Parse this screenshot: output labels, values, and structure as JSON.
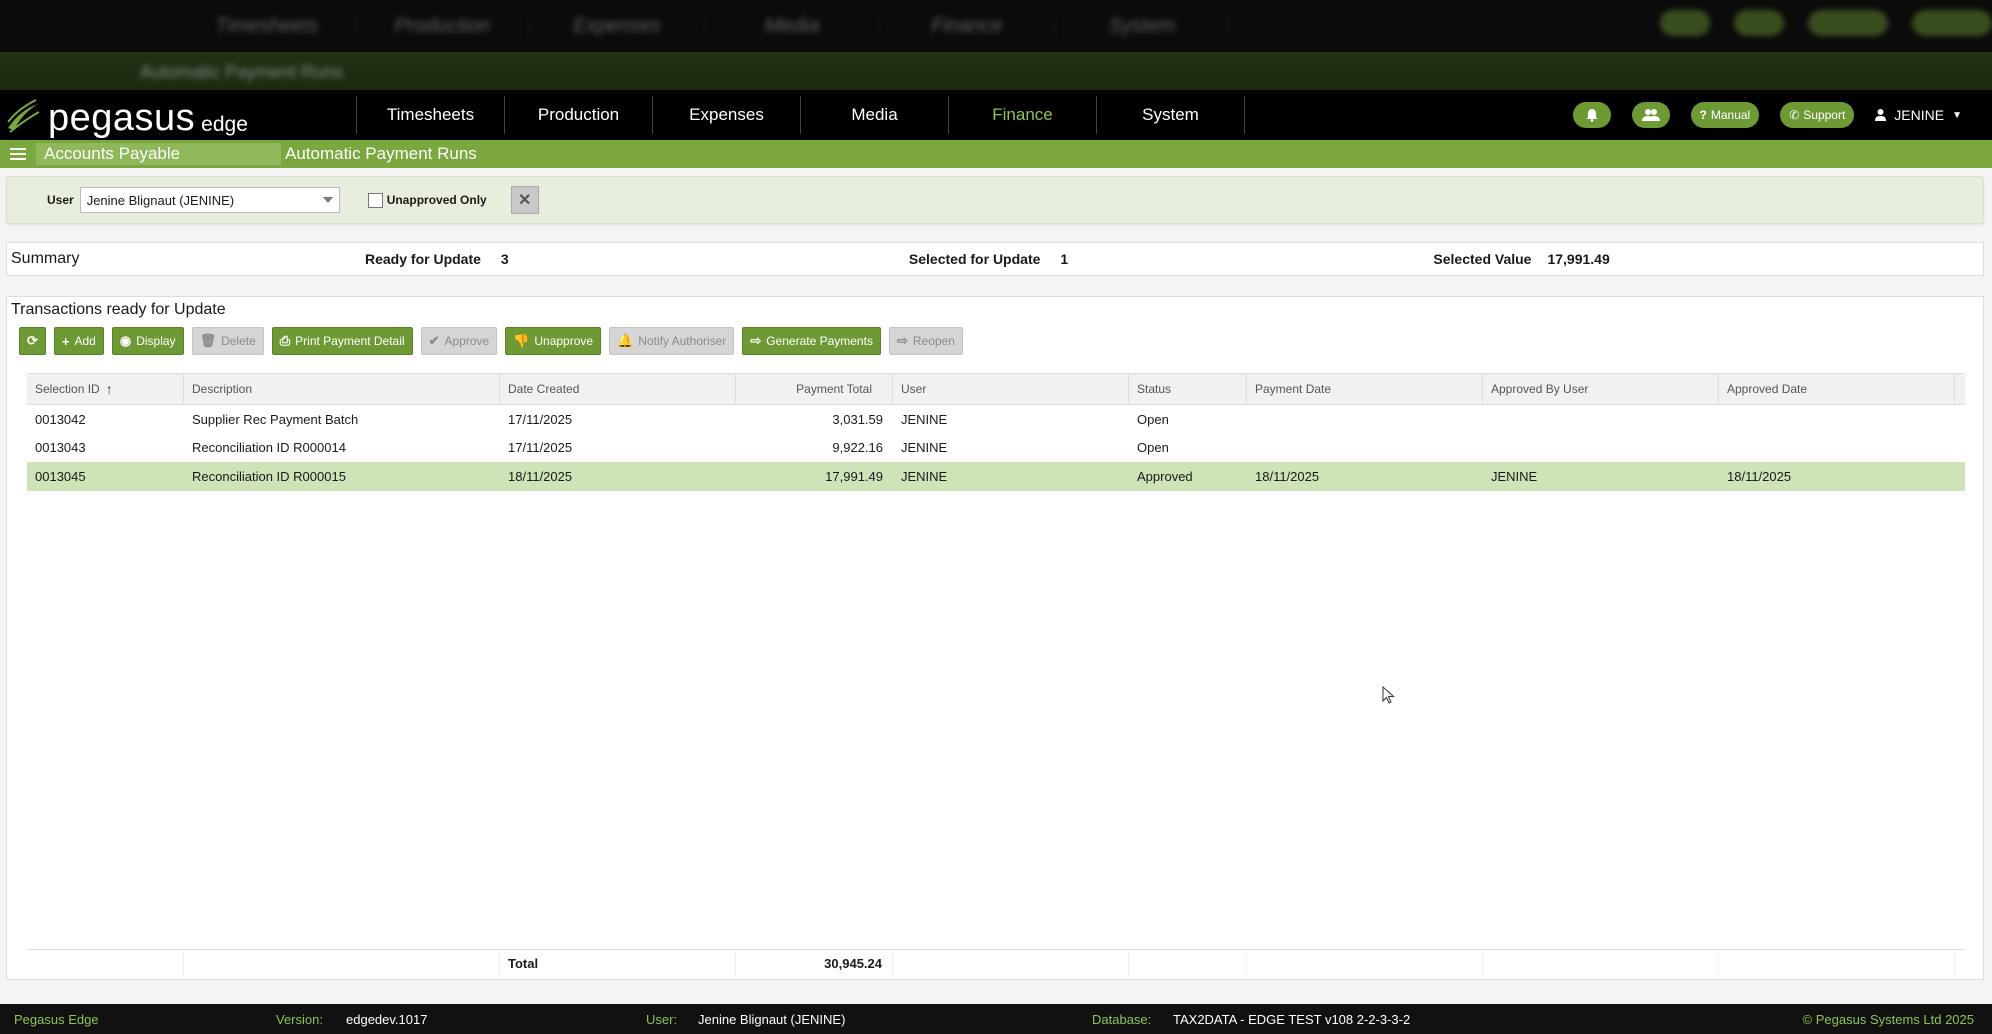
{
  "app": {
    "logo_text": "pegasus",
    "logo_sub": "edge",
    "accent": "#7aa83e"
  },
  "nav": {
    "items": [
      {
        "label": "Timesheets"
      },
      {
        "label": "Production"
      },
      {
        "label": "Expenses"
      },
      {
        "label": "Media"
      },
      {
        "label": "Finance",
        "active": true
      },
      {
        "label": "System"
      }
    ],
    "manual_label": "Manual",
    "support_label": "Support",
    "user_label": "JENINE"
  },
  "breadcrumb": {
    "module": "Accounts Payable",
    "page": "Automatic Payment Runs"
  },
  "filter": {
    "user_label": "User",
    "user_value": "Jenine Blignaut (JENINE)",
    "unapproved_label": "Unapproved Only",
    "unapproved_checked": false
  },
  "summary": {
    "title": "Summary",
    "ready_label": "Ready for Update",
    "ready_value": "3",
    "selected_label": "Selected for Update",
    "selected_value": "1",
    "value_label": "Selected Value",
    "value_value": "17,991.49"
  },
  "panel": {
    "title": "Transactions ready for Update"
  },
  "toolbar": {
    "add": "Add",
    "display": "Display",
    "delete": "Delete",
    "print": "Print Payment Detail",
    "approve": "Approve",
    "unapprove": "Unapprove",
    "notify": "Notify Authoriser",
    "generate": "Generate Payments",
    "reopen": "Reopen"
  },
  "table": {
    "columns": [
      "Selection ID",
      "Description",
      "Date Created",
      "Payment Total",
      "User",
      "Status",
      "Payment Date",
      "Approved By User",
      "Approved Date"
    ],
    "rows": [
      [
        "0013042",
        "Supplier Rec Payment Batch",
        "17/11/2025",
        "3,031.59",
        "JENINE",
        "Open",
        "",
        "",
        ""
      ],
      [
        "0013043",
        "Reconciliation ID R000014",
        "17/11/2025",
        "9,922.16",
        "JENINE",
        "Open",
        "",
        "",
        ""
      ],
      [
        "0013045",
        "Reconciliation ID R000015",
        "18/11/2025",
        "17,991.49",
        "JENINE",
        "Approved",
        "18/11/2025",
        "JENINE",
        "18/11/2025"
      ]
    ],
    "total_label": "Total",
    "total_value": "30,945.24"
  },
  "statusbar": {
    "app_name": "Pegasus Edge",
    "version_label": "Version:",
    "version_value": "edgedev.1017",
    "user_label": "User:",
    "user_value": "Jenine Blignaut (JENINE)",
    "database_label": "Database:",
    "database_value": "TAX2DATA - EDGE TEST v108 2-2-3-3-2",
    "copyright": "© Pegasus Systems Ltd 2025"
  }
}
